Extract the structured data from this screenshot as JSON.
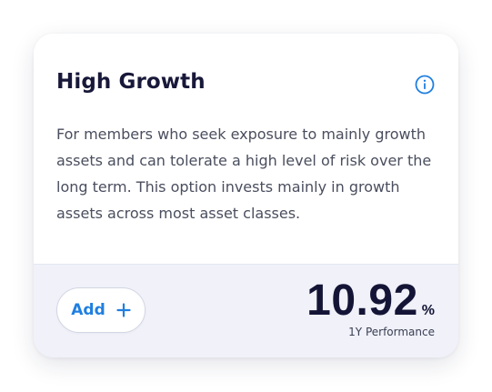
{
  "fund_card": {
    "title": "High Growth",
    "info_icon": "info-circle-icon",
    "description": "For members who seek exposure to mainly growth assets and can tolerate a high level of risk over the long term. This option invests mainly in growth assets across most asset classes.",
    "add_button": {
      "label": "Add",
      "icon": "plus-icon"
    },
    "performance": {
      "value": "10.92",
      "unit": "%",
      "label": "1Y Performance"
    }
  },
  "colors": {
    "title_text": "#18183a",
    "body_text": "#4a4e5e",
    "accent_blue": "#1f7fe0",
    "footer_background": "#f0f1f9",
    "value_text": "#141536"
  }
}
